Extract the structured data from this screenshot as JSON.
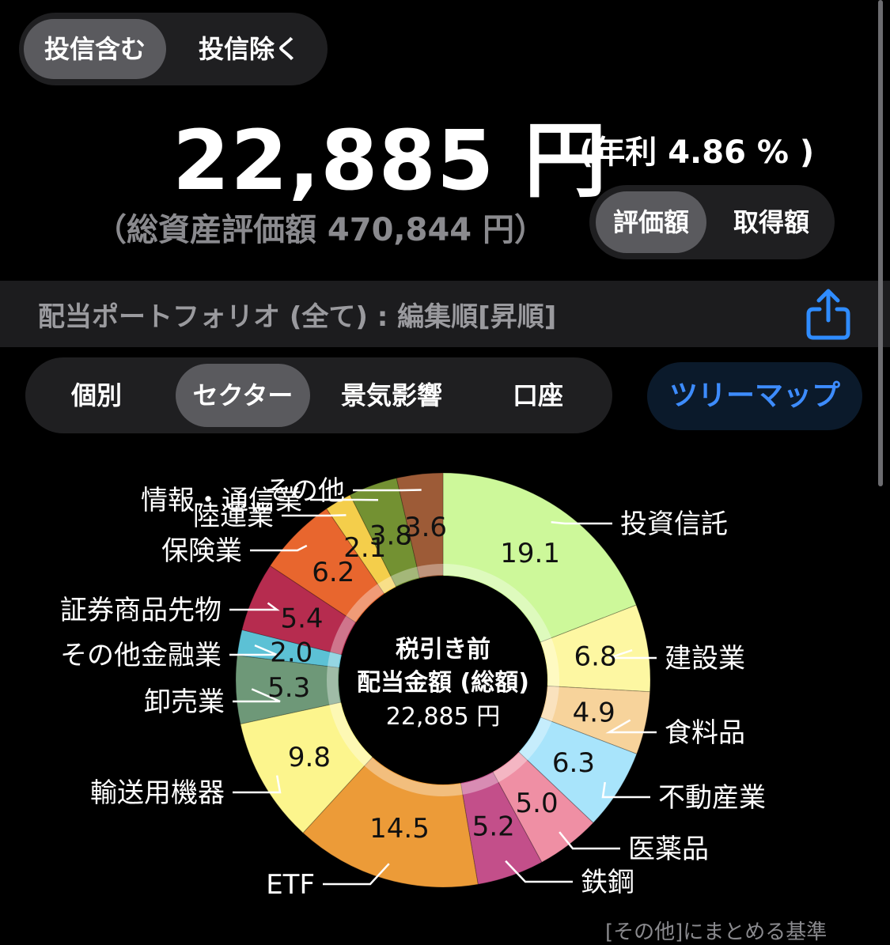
{
  "top_toggle": {
    "include_label": "投信含む",
    "exclude_label": "投信除く"
  },
  "summary": {
    "amount": "22,885 円",
    "rate": "(年利 4.86 % )",
    "total": "（総資産評価額 470,844 円）"
  },
  "value_toggle": {
    "eval_label": "評価額",
    "cost_label": "取得額"
  },
  "portfolio": {
    "title": "配当ポートフォリオ (全て) : 編集順[昇順]",
    "share_icon": "share-icon"
  },
  "view_tabs": {
    "tabs": [
      "個別",
      "セクター",
      "景気影響",
      "口座"
    ],
    "treemap_label": "ツリーマップ"
  },
  "center_label": {
    "line1": "税引き前",
    "line2": "配当金額 (総額)",
    "line3": "22,885 円"
  },
  "footnote": "[その他]にまとめる基準",
  "chart_data": {
    "type": "pie",
    "donut": true,
    "unit": "%",
    "slices": [
      {
        "label": "投資信託",
        "value": 19.1,
        "color": "#cdf89a"
      },
      {
        "label": "建設業",
        "value": 6.8,
        "color": "#fdf7a2"
      },
      {
        "label": "食料品",
        "value": 4.9,
        "color": "#f7d39b"
      },
      {
        "label": "不動産業",
        "value": 6.3,
        "color": "#a8e4fb"
      },
      {
        "label": "医薬品",
        "value": 5.0,
        "color": "#ef8fa4"
      },
      {
        "label": "鉄鋼",
        "value": 5.2,
        "color": "#c34f8a"
      },
      {
        "label": "ETF",
        "value": 14.5,
        "color": "#ec9b38"
      },
      {
        "label": "輸送用機器",
        "value": 9.8,
        "color": "#fcf58d"
      },
      {
        "label": "卸売業",
        "value": 5.3,
        "color": "#6e9878"
      },
      {
        "label": "その他金融業",
        "value": 2.0,
        "color": "#5cc1d5"
      },
      {
        "label": "証券商品先物",
        "value": 5.4,
        "color": "#b62c4f"
      },
      {
        "label": "保険業",
        "value": 6.2,
        "color": "#e8662e"
      },
      {
        "label": "陸運業",
        "value": 2.1,
        "color": "#f4ce4b"
      },
      {
        "label": "情報・通信業",
        "value": 3.8,
        "color": "#739132"
      },
      {
        "label": "その他",
        "value": 3.6,
        "color": "#9d5b37"
      }
    ]
  }
}
